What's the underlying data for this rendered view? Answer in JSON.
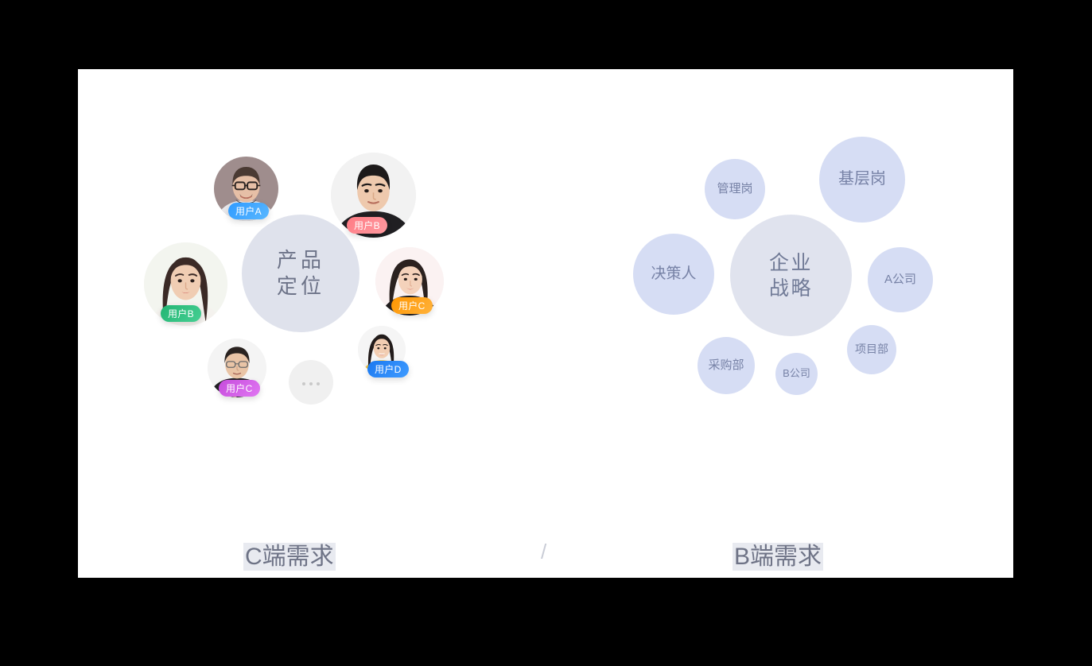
{
  "page": {
    "background_color": "#000000",
    "panel_color": "#ffffff"
  },
  "left_cluster": {
    "name": "C端需求 user cluster",
    "core": {
      "line1": "产品",
      "line2": "定位",
      "color": "#dfe2ec",
      "text_color": "#6d7388"
    },
    "more_node": {
      "label": "...",
      "color": "#f0f0f0"
    },
    "avatars": [
      {
        "id": "user-a",
        "badge_label": "用户A",
        "badge_color_start": "#2f9bff",
        "badge_color_end": "#59b7ff",
        "glow_color": "#7cc2ff",
        "photo": "bearded-man-with-glasses",
        "bg": "#9f8d8d",
        "skin": "#e6bfa6",
        "hair": "#4a3a33",
        "shirt": "#e9e9ec"
      },
      {
        "id": "user-b-top",
        "badge_label": "用户B",
        "badge_color_start": "#ff7b84",
        "badge_color_end": "#ff9aa0",
        "glow_color": "#ffb3b8",
        "photo": "young-man-black-tshirt",
        "bg": "#f2f2f2",
        "skin": "#eec9ad",
        "hair": "#1d1a1a",
        "shirt": "#201f22"
      },
      {
        "id": "user-b-left",
        "badge_label": "用户B",
        "badge_color_start": "#23b573",
        "badge_color_end": "#46cf93",
        "glow_color": "#7ae0b2",
        "photo": "long-hair-woman-white-top",
        "bg": "#f3f5ef",
        "skin": "#f0cdb3",
        "hair": "#3b2a26",
        "shirt": "#f4f2ee"
      },
      {
        "id": "user-c-right",
        "badge_label": "用户C",
        "badge_color_start": "#ff9500",
        "badge_color_end": "#ffb33c",
        "glow_color": "#ffd28f",
        "photo": "smiling-woman-dark-top",
        "bg": "#fbf2f2",
        "skin": "#f4d2bb",
        "hair": "#2b211f",
        "shirt": "#1f1c1d"
      },
      {
        "id": "user-c-bottom",
        "badge_label": "用户C",
        "badge_color_start": "#c64bdc",
        "badge_color_end": "#e077f2",
        "glow_color": "#e9a6f7",
        "photo": "man-glasses-hand-on-chin",
        "bg": "#f4f4f4",
        "skin": "#e9c4a6",
        "hair": "#2a2320",
        "shirt": "#232225"
      },
      {
        "id": "user-d",
        "badge_label": "用户D",
        "badge_color_start": "#1a78f0",
        "badge_color_end": "#3f9bff",
        "glow_color": "#8cc3ff",
        "photo": "young-woman-yellow-top",
        "bg": "#f5f5f5",
        "skin": "#f2cdb2",
        "hair": "#221b1a",
        "shirt": "#f0c33c"
      }
    ]
  },
  "right_cluster": {
    "name": "B端需求 enterprise cluster",
    "core": {
      "line1": "企业",
      "line2": "战略",
      "color": "#e0e3ee",
      "text_color": "#707a96"
    },
    "node_color": "#d6ddf4",
    "node_text_color": "#7782a6",
    "nodes": [
      {
        "id": "node-management",
        "label": "管理岗"
      },
      {
        "id": "node-frontline",
        "label": "基层岗"
      },
      {
        "id": "node-decider",
        "label": "决策人"
      },
      {
        "id": "node-company-a",
        "label": "A公司"
      },
      {
        "id": "node-purchasing",
        "label": "采购部"
      },
      {
        "id": "node-company-b",
        "label": "B公司"
      },
      {
        "id": "node-project",
        "label": "项目部"
      }
    ]
  },
  "footer": {
    "left_label": "C端需求",
    "separator": "/",
    "right_label": "B端需求",
    "text_color": "#6e7386",
    "highlight_color": "#e8eaf0"
  }
}
